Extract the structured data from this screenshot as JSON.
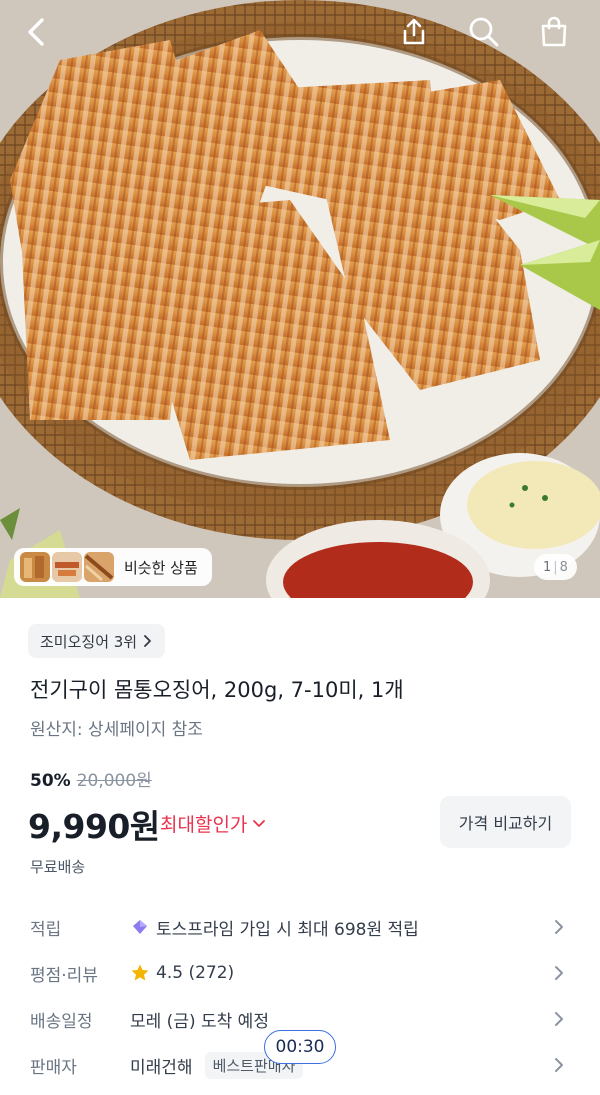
{
  "topbar": {
    "back_icon": "chevron-left-icon",
    "share_icon": "share-icon",
    "search_icon": "search-icon",
    "cart_icon": "shopping-bag-icon"
  },
  "hero": {
    "image_subject": "grilled whole squid on a woven basket tray with lime wedges and dipping sauces",
    "similar_label": "비슷한 상품",
    "page_current": "1",
    "page_total": "8"
  },
  "product": {
    "rank_label": "조미오징어 3위",
    "title": "전기구이 몸통오징어, 200g, 7-10미, 1개",
    "origin": "원산지: 상세페이지 참조",
    "discount": "50%",
    "original_price": "20,000원",
    "price": "9,990원",
    "max_discount_label": "최대할인가",
    "compare_button": "가격 비교하기",
    "shipping": "무료배송"
  },
  "details": {
    "points_key": "적립",
    "points_value": "토스프라임 가입 시 최대 698원 적립",
    "rating_key": "평점·리뷰",
    "rating_value": "4.5 (272)",
    "delivery_key": "배송일정",
    "delivery_value": "모레 (금) 도착 예정",
    "seller_key": "판매자",
    "seller_value": "미래건해",
    "seller_badge": "베스트판매자"
  },
  "overlay": {
    "timer": "00:30"
  },
  "colors": {
    "accent_red": "#e8344e",
    "timer_border": "#3d6fe0",
    "star": "#f5b400"
  }
}
